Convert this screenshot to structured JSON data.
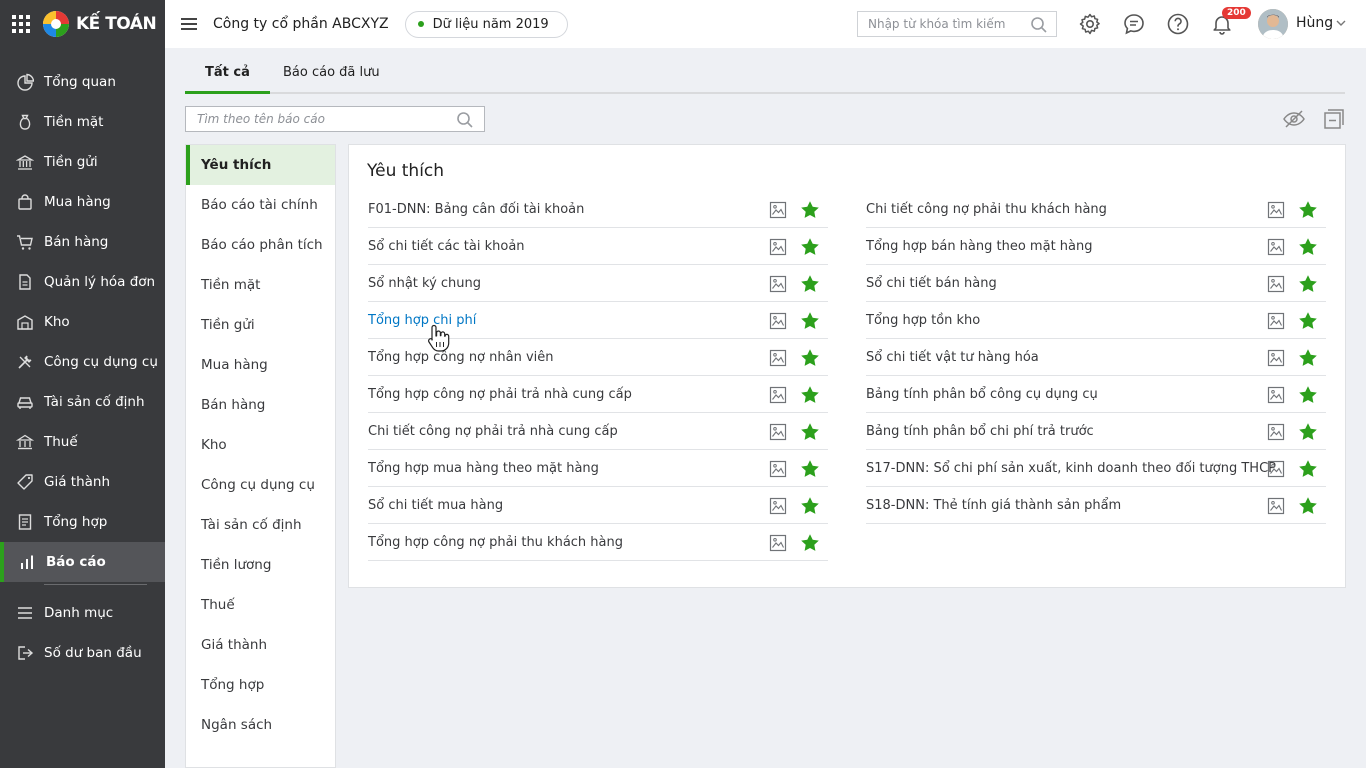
{
  "brand": {
    "name": "KẾ TOÁN"
  },
  "sidebar": {
    "items": [
      {
        "label": "Tổng quan",
        "icon": "pie-chart-icon"
      },
      {
        "label": "Tiền mặt",
        "icon": "money-bag-icon"
      },
      {
        "label": "Tiền gửi",
        "icon": "bank-icon"
      },
      {
        "label": "Mua hàng",
        "icon": "shopping-bag-icon"
      },
      {
        "label": "Bán hàng",
        "icon": "cart-icon"
      },
      {
        "label": "Quản lý hóa đơn",
        "icon": "invoice-icon"
      },
      {
        "label": "Kho",
        "icon": "warehouse-icon"
      },
      {
        "label": "Công cụ dụng cụ",
        "icon": "tools-icon"
      },
      {
        "label": "Tài sản cố định",
        "icon": "car-icon"
      },
      {
        "label": "Thuế",
        "icon": "government-icon"
      },
      {
        "label": "Giá thành",
        "icon": "price-tag-icon"
      },
      {
        "label": "Tổng hợp",
        "icon": "document-icon"
      },
      {
        "label": "Báo cáo",
        "icon": "bar-chart-icon"
      }
    ],
    "items2": [
      {
        "label": "Danh mục",
        "icon": "list-icon"
      },
      {
        "label": "Số dư ban đầu",
        "icon": "import-icon"
      }
    ]
  },
  "topbar": {
    "company": "Công ty cổ phần ABCXYZ",
    "year": "Dữ liệu năm 2019",
    "search_placeholder": "Nhập từ khóa tìm kiếm",
    "notification_count": "200",
    "user_name": "Hùng"
  },
  "tabs": [
    {
      "label": "Tất cả"
    },
    {
      "label": "Báo cáo đã lưu"
    }
  ],
  "report_search": {
    "placeholder": "Tìm theo tên báo cáo"
  },
  "categories": [
    "Yêu thích",
    "Báo cáo tài chính",
    "Báo cáo phân tích",
    "Tiền mặt",
    "Tiền gửi",
    "Mua hàng",
    "Bán hàng",
    "Kho",
    "Công cụ dụng cụ",
    "Tài sản cố định",
    "Tiền lương",
    "Thuế",
    "Giá thành",
    "Tổng hợp",
    "Ngân sách"
  ],
  "content": {
    "title": "Yêu thích",
    "left": [
      "F01-DNN: Bảng cân đối tài khoản",
      "Sổ chi tiết các tài khoản",
      "Sổ nhật ký chung",
      "Tổng hợp chi phí",
      "Tổng hợp công nợ nhân viên",
      "Tổng hợp công nợ phải trả nhà cung cấp",
      "Chi tiết công nợ phải trả nhà cung cấp",
      "Tổng hợp mua hàng theo mặt hàng",
      "Sổ chi tiết mua hàng",
      "Tổng hợp công nợ phải thu khách hàng"
    ],
    "right": [
      "Chi tiết công nợ phải thu khách hàng",
      "Tổng hợp bán hàng theo mặt hàng",
      "Sổ chi tiết bán hàng",
      "Tổng hợp tồn kho",
      "Sổ chi tiết vật tư hàng hóa",
      "Bảng tính phân bổ công cụ dụng cụ",
      "Bảng tính phân bổ chi phí trả trước",
      "S17-DNN: Sổ chi phí sản xuất, kinh doanh theo đối tượng THCP",
      "S18-DNN: Thẻ tính giá thành sản phẩm"
    ]
  },
  "colors": {
    "accent": "#2ca01c",
    "sidebar_bg": "#393a3d",
    "link": "#0077c5",
    "badge": "#e53935"
  }
}
